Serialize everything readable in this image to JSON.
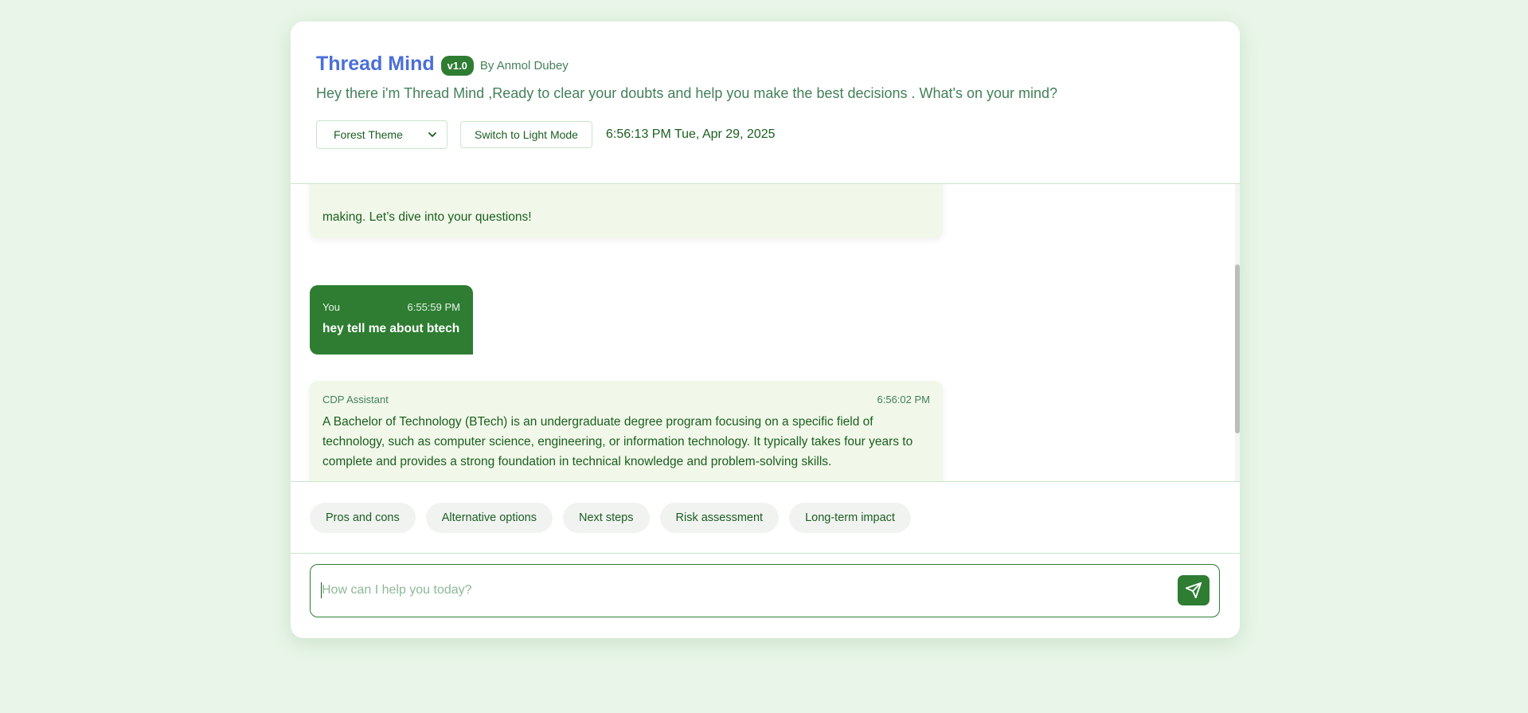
{
  "header": {
    "title": "Thread Mind",
    "version": "v1.0",
    "author": "By Anmol Dubey",
    "subtitle": "Hey there i'm Thread Mind ,Ready to clear your doubts and help you make the best decisions . What's on your mind?",
    "theme_select": {
      "selected": "Forest Theme"
    },
    "mode_button": "Switch to Light Mode",
    "clock": "6:56:13 PM Tue, Apr 29, 2025"
  },
  "messages": [
    {
      "role": "assistant",
      "text": "making. Let’s dive into your questions!"
    },
    {
      "role": "user",
      "sender": "You",
      "time": "6:55:59 PM",
      "text": "hey tell me about btech"
    },
    {
      "role": "assistant",
      "sender": "CDP Assistant",
      "time": "6:56:02 PM",
      "text": "A Bachelor of Technology (BTech) is an undergraduate degree program focusing on a specific field of technology, such as computer science, engineering, or information technology.  It typically takes four years to complete and provides a strong foundation in technical knowledge and problem-solving skills."
    }
  ],
  "suggestions": [
    "Pros and cons",
    "Alternative options",
    "Next steps",
    "Risk assessment",
    "Long-term impact"
  ],
  "input": {
    "placeholder": "How can I help you today?",
    "value": ""
  },
  "icons": {
    "theme_select": "chevron-down-icon",
    "send": "send-icon"
  },
  "colors": {
    "background": "#e8f5e8",
    "primary": "#2e7d32",
    "title": "#4a6fd8",
    "assistant_bubble": "#f1f8e9"
  }
}
